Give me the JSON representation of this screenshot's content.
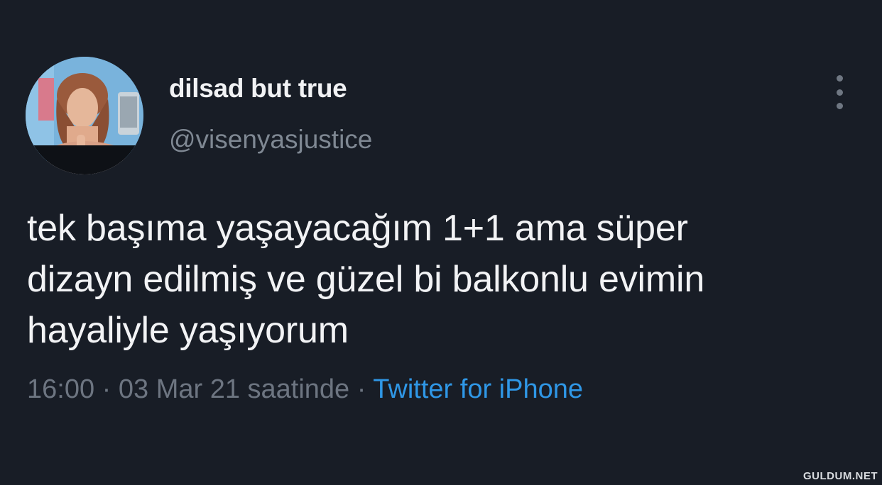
{
  "user": {
    "display_name": "dilsad but true",
    "handle": "@visenyasjustice",
    "avatar_icon": "profile-photo"
  },
  "menu": {
    "icon": "more-vertical-icon"
  },
  "tweet": {
    "lines": [
      "tek başıma yaşayacağım 1+1 ama süper",
      "dizayn edilmiş ve güzel bi balkonlu evimin",
      "hayaliyle yaşıyorum"
    ]
  },
  "meta": {
    "time": "16:00",
    "separator1": " · ",
    "date": "03 Mar 21 saatinde",
    "separator2": " · ",
    "source": "Twitter for iPhone"
  },
  "watermark": "GULDUM.NET",
  "colors": {
    "background": "#181d26",
    "text": "#f2f3f5",
    "muted": "#6d7581",
    "link": "#2f97e6"
  }
}
